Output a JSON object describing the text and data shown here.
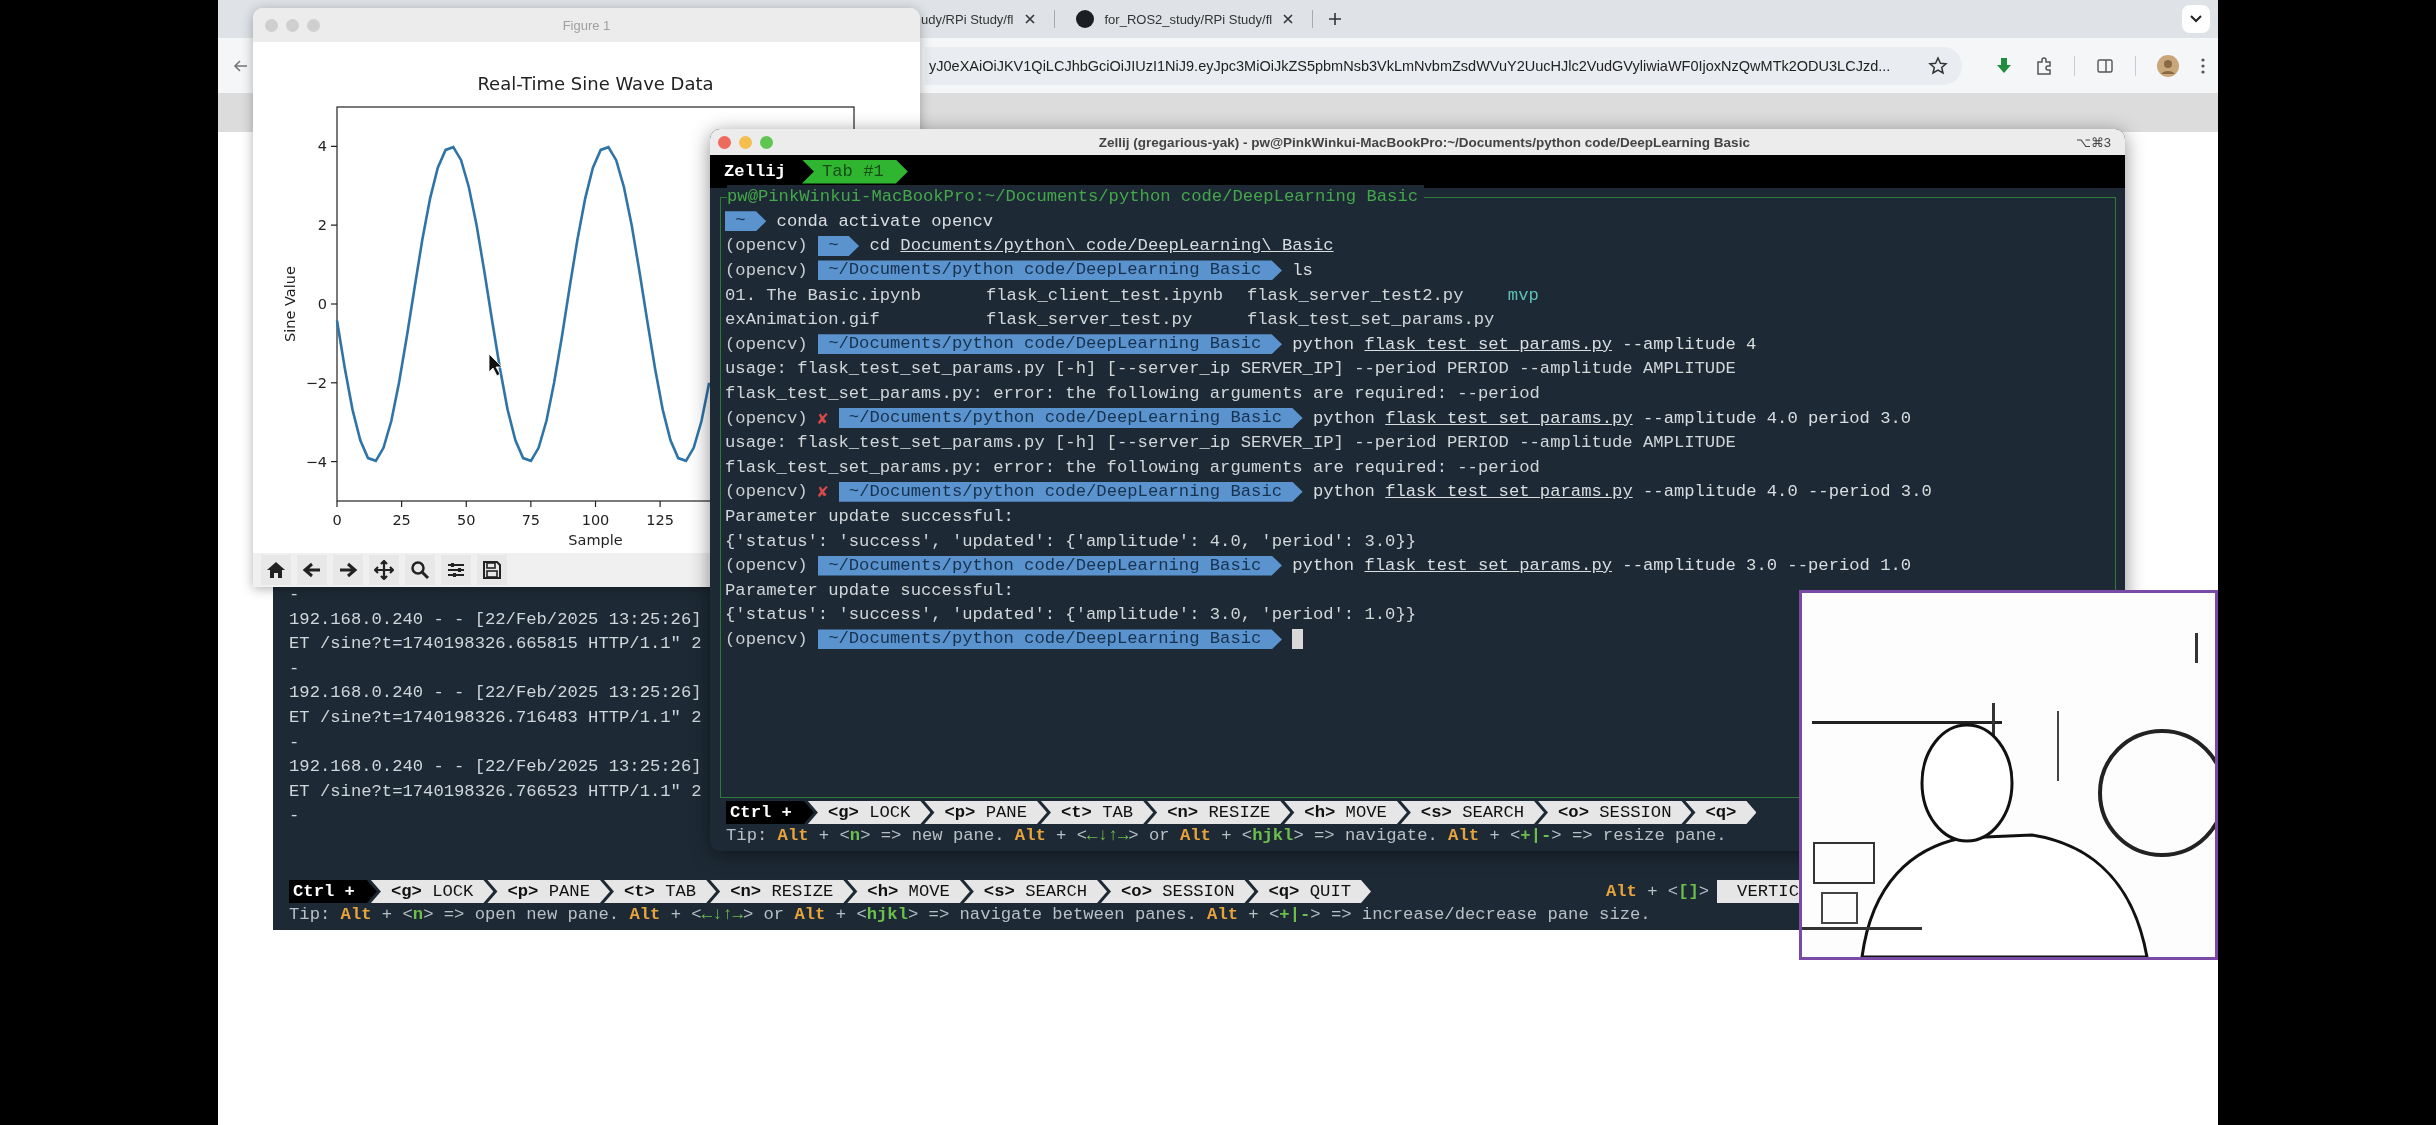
{
  "browser": {
    "tabs": [
      {
        "title": "udy/RPi Study/fl",
        "selected": false,
        "favicon": false
      },
      {
        "title": "for_ROS2_study/RPi Study/fl",
        "selected": false,
        "favicon": true
      }
    ],
    "address": "yJ0eXAiOiJKV1QiLCJhbGciOiJIUzI1NiJ9.eyJpc3MiOiJkZS5pbmNsb3VkLmNvbmZsdWVuY2UucHJlc2VudGVyliwiaWF0IjoxNzQwMTk2ODU3LCJzd..."
  },
  "figure": {
    "title": "Figure 1",
    "chart_data": {
      "type": "line",
      "title": "Real-Time Sine Wave Data",
      "xlabel": "Sample",
      "ylabel": "Sine Value",
      "x": [
        0,
        3,
        6,
        9,
        12,
        15,
        18,
        21,
        24,
        27,
        30,
        33,
        36,
        39,
        42,
        45,
        48,
        51,
        54,
        57,
        60,
        63,
        66,
        69,
        72,
        75,
        78,
        81,
        84,
        87,
        90,
        93,
        96,
        99,
        102,
        105,
        108,
        111,
        114,
        117,
        120,
        123,
        126,
        129,
        132,
        135,
        138,
        141,
        144
      ],
      "series": [
        {
          "color": "#2f74a8",
          "values": [
            -0.42,
            -1.63,
            -2.68,
            -3.46,
            -3.91,
            -3.98,
            -3.65,
            -2.97,
            -2.0,
            -0.83,
            0.42,
            1.63,
            2.68,
            3.46,
            3.91,
            3.98,
            3.65,
            2.97,
            2.0,
            0.83,
            -0.42,
            -1.63,
            -2.68,
            -3.46,
            -3.91,
            -3.98,
            -3.65,
            -2.97,
            -2.0,
            -0.83,
            0.42,
            1.63,
            2.68,
            3.46,
            3.91,
            3.98,
            3.65,
            2.97,
            2.0,
            0.83,
            -0.42,
            -1.63,
            -2.68,
            -3.46,
            -3.91,
            -3.98,
            -3.65,
            -2.97,
            -2.0
          ]
        }
      ],
      "xlim": [
        0,
        200
      ],
      "ylim": [
        -5,
        5
      ],
      "xticks": [
        0,
        25,
        50,
        75,
        100,
        125
      ],
      "yticks": [
        {
          "value": -4,
          "label": "−4"
        },
        {
          "value": -2,
          "label": "−2"
        },
        0,
        2,
        4
      ]
    }
  },
  "back_terminal": {
    "log": [
      "-",
      "192.168.0.240 - - [22/Feb/2025 13:25:26]",
      "ET /sine?t=1740198326.665815 HTTP/1.1\" 2",
      "-",
      "192.168.0.240 - - [22/Feb/2025 13:25:26]",
      "ET /sine?t=1740198326.716483 HTTP/1.1\" 2",
      "-",
      "192.168.0.240 - - [22/Feb/2025 13:25:26]",
      "ET /sine?t=1740198326.766523 HTTP/1.1\" 2",
      "-"
    ],
    "mode": "Ctrl +",
    "keys": [
      {
        "key": "<g>",
        "label": "LOCK"
      },
      {
        "key": "<p>",
        "label": "PANE"
      },
      {
        "key": "<t>",
        "label": "TAB"
      },
      {
        "key": "<n>",
        "label": "RESIZE"
      },
      {
        "key": "<h>",
        "label": "MOVE"
      },
      {
        "key": "<s>",
        "label": "SEARCH"
      },
      {
        "key": "<o>",
        "label": "SESSION"
      },
      {
        "key": "<q>",
        "label": "QUIT"
      }
    ],
    "hint": [
      {
        "text": "Alt",
        "kind": "key"
      },
      {
        "text": " + <",
        "kind": "plain"
      },
      {
        "text": "[]",
        "kind": "arg"
      },
      {
        "text": ">",
        "kind": "plain"
      }
    ],
    "layout": "VERTIC",
    "tip": [
      {
        "text": "Tip: ",
        "kind": "plain"
      },
      {
        "text": "Alt",
        "kind": "key"
      },
      {
        "text": " + <",
        "kind": "plain"
      },
      {
        "text": "n",
        "kind": "arg"
      },
      {
        "text": "> => open new pane. ",
        "kind": "plain"
      },
      {
        "text": "Alt",
        "kind": "key"
      },
      {
        "text": " + <",
        "kind": "plain"
      },
      {
        "text": "←↓↑→",
        "kind": "arg"
      },
      {
        "text": "> or ",
        "kind": "plain"
      },
      {
        "text": "Alt",
        "kind": "key"
      },
      {
        "text": " + <",
        "kind": "plain"
      },
      {
        "text": "hjkl",
        "kind": "arg"
      },
      {
        "text": "> => navigate between panes. ",
        "kind": "plain"
      },
      {
        "text": "Alt",
        "kind": "key"
      },
      {
        "text": " + <",
        "kind": "plain"
      },
      {
        "text": "+|-",
        "kind": "arg"
      },
      {
        "text": "> => increase/decrease pane size.",
        "kind": "plain"
      }
    ]
  },
  "zellij": {
    "title": "Zellij (gregarious-yak) - pw@PinkWinkui-MacBookPro:~/Documents/python code/DeepLearning Basic",
    "shortcut": "⌥⌘3",
    "app_name": "Zellij",
    "tabs": [
      {
        "label": "Tab #1",
        "selected": true
      }
    ],
    "pane_title": "pw@PinkWinkui-MacBookPro:~/Documents/python code/DeepLearning Basic",
    "lines": [
      {
        "kind": "prompt",
        "path": "~",
        "command": [
          {
            "text": "conda activate opencv",
            "underline": false
          }
        ]
      },
      {
        "kind": "prompt",
        "env": "(opencv)",
        "path": "~",
        "command": [
          {
            "text": "cd ",
            "underline": false
          },
          {
            "text": "Documents/python\\ code/DeepLearning\\ Basic",
            "underline": true
          }
        ]
      },
      {
        "kind": "prompt",
        "env": "(opencv)",
        "path": "~/Documents/python code/DeepLearning Basic",
        "command": [
          {
            "text": "ls",
            "underline": false
          }
        ]
      },
      {
        "kind": "listing",
        "items": [
          {
            "name": "01. The Basic.ipynb",
            "kind": "file"
          },
          {
            "name": "flask_client_test.ipynb",
            "kind": "file"
          },
          {
            "name": "flask_server_test2.py",
            "kind": "file"
          },
          {
            "name": "mvp",
            "kind": "dir"
          }
        ]
      },
      {
        "kind": "listing",
        "items": [
          {
            "name": "exAnimation.gif",
            "kind": "file"
          },
          {
            "name": "flask_server_test.py",
            "kind": "file"
          },
          {
            "name": "flask_test_set_params.py",
            "kind": "file"
          }
        ]
      },
      {
        "kind": "prompt",
        "env": "(opencv)",
        "path": "~/Documents/python code/DeepLearning Basic",
        "command": [
          {
            "text": "python ",
            "underline": false
          },
          {
            "text": "flask_test_set_params.py",
            "underline": true
          },
          {
            "text": " --amplitude 4",
            "underline": false
          }
        ]
      },
      {
        "kind": "output",
        "text": "usage: flask_test_set_params.py [-h] [--server_ip SERVER_IP] --period PERIOD --amplitude AMPLITUDE"
      },
      {
        "kind": "output",
        "text": "flask_test_set_params.py: error: the following arguments are required: --period"
      },
      {
        "kind": "prompt",
        "env": "(opencv)",
        "error_mark": "✘",
        "path": "~/Documents/python code/DeepLearning Basic",
        "command": [
          {
            "text": "python ",
            "underline": false
          },
          {
            "text": "flask_test_set_params.py",
            "underline": true
          },
          {
            "text": " --amplitude 4.0 period 3.0",
            "underline": false
          }
        ]
      },
      {
        "kind": "output",
        "text": "usage: flask_test_set_params.py [-h] [--server_ip SERVER_IP] --period PERIOD --amplitude AMPLITUDE"
      },
      {
        "kind": "output",
        "text": "flask_test_set_params.py: error: the following arguments are required: --period"
      },
      {
        "kind": "prompt",
        "env": "(opencv)",
        "error_mark": "✘",
        "path": "~/Documents/python code/DeepLearning Basic",
        "command": [
          {
            "text": "python ",
            "underline": false
          },
          {
            "text": "flask_test_set_params.py",
            "underline": true
          },
          {
            "text": " --amplitude 4.0 --period 3.0",
            "underline": false
          }
        ]
      },
      {
        "kind": "output",
        "text": "Parameter update successful:"
      },
      {
        "kind": "output",
        "text": "{'status': 'success', 'updated': {'amplitude': 4.0, 'period': 3.0}}"
      },
      {
        "kind": "prompt",
        "env": "(opencv)",
        "path": "~/Documents/python code/DeepLearning Basic",
        "command": [
          {
            "text": "python ",
            "underline": false
          },
          {
            "text": "flask_test_set_params.py",
            "underline": true
          },
          {
            "text": " --amplitude 3.0 --period 1.0",
            "underline": false
          }
        ]
      },
      {
        "kind": "output",
        "text": "Parameter update successful:"
      },
      {
        "kind": "output",
        "text": "{'status': 'success', 'updated': {'amplitude': 3.0, 'period': 1.0}}"
      },
      {
        "kind": "prompt",
        "env": "(opencv)",
        "path": "~/Documents/python code/DeepLearning Basic",
        "cursor": true
      }
    ],
    "mode": "Ctrl +",
    "keys": [
      {
        "key": "<g>",
        "label": "LOCK"
      },
      {
        "key": "<p>",
        "label": "PANE"
      },
      {
        "key": "<t>",
        "label": "TAB"
      },
      {
        "key": "<n>",
        "label": "RESIZE"
      },
      {
        "key": "<h>",
        "label": "MOVE"
      },
      {
        "key": "<s>",
        "label": "SEARCH"
      },
      {
        "key": "<o>",
        "label": "SESSION"
      },
      {
        "key": "<q>"
      }
    ],
    "tip": [
      {
        "text": "Tip: ",
        "kind": "plain"
      },
      {
        "text": "Alt",
        "kind": "key"
      },
      {
        "text": " + <",
        "kind": "plain"
      },
      {
        "text": "n",
        "kind": "arg"
      },
      {
        "text": "> => new pane. ",
        "kind": "plain"
      },
      {
        "text": "Alt",
        "kind": "key"
      },
      {
        "text": " + <",
        "kind": "plain"
      },
      {
        "text": "←↓↑→",
        "kind": "arg"
      },
      {
        "text": "> or ",
        "kind": "plain"
      },
      {
        "text": "Alt",
        "kind": "key"
      },
      {
        "text": " + <",
        "kind": "plain"
      },
      {
        "text": "hjkl",
        "kind": "arg"
      },
      {
        "text": "> => navigate. ",
        "kind": "plain"
      },
      {
        "text": "Alt",
        "kind": "key"
      },
      {
        "text": " + <",
        "kind": "plain"
      },
      {
        "text": "+|-",
        "kind": "arg"
      },
      {
        "text": "> => resize pane.",
        "kind": "plain"
      }
    ]
  }
}
